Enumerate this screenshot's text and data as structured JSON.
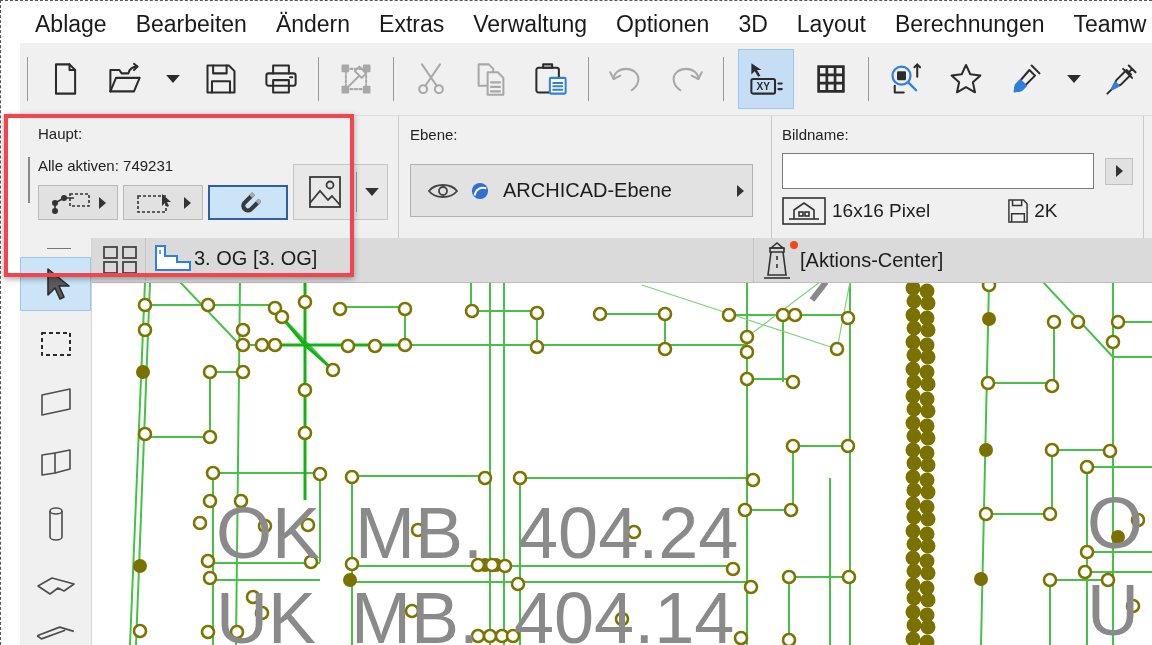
{
  "menu_bar": [
    "Ablage",
    "Bearbeiten",
    "Ändern",
    "Extras",
    "Verwaltung",
    "Optionen",
    "3D",
    "Layout",
    "Berechnungen",
    "Teamw"
  ],
  "toolbar": {
    "groups": [
      [
        {
          "kind": "button",
          "disabled": false,
          "selected": false
        },
        {
          "kind": "button",
          "disabled": false,
          "selected": false
        },
        {
          "kind": "dropdown",
          "disabled": false,
          "selected": false
        },
        {
          "kind": "button",
          "disabled": false,
          "selected": false
        },
        {
          "kind": "button",
          "disabled": false,
          "selected": false
        }
      ],
      [
        {
          "kind": "button",
          "disabled": true,
          "selected": false
        }
      ],
      [
        {
          "kind": "button",
          "disabled": true,
          "selected": false
        },
        {
          "kind": "button",
          "disabled": true,
          "selected": false
        },
        {
          "kind": "button",
          "disabled": false,
          "selected": false
        }
      ],
      [
        {
          "kind": "button",
          "disabled": true,
          "selected": false
        },
        {
          "kind": "button",
          "disabled": true,
          "selected": false
        }
      ],
      [
        {
          "kind": "button",
          "disabled": false,
          "selected": true,
          "icon_text": "XY"
        },
        {
          "kind": "button",
          "disabled": false,
          "selected": false
        }
      ],
      [
        {
          "kind": "button",
          "disabled": false,
          "selected": false
        },
        {
          "kind": "button",
          "disabled": false,
          "selected": false
        },
        {
          "kind": "button",
          "disabled": false,
          "selected": false
        },
        {
          "kind": "dropdown",
          "disabled": false,
          "selected": false
        },
        {
          "kind": "button",
          "disabled": false,
          "selected": false
        }
      ]
    ]
  },
  "info_box": {
    "main": {
      "label": "Haupt:",
      "count": "Alle aktiven: 749231",
      "buttons": [
        {
          "kind": "popup",
          "selected": false
        },
        {
          "kind": "popup",
          "selected": false
        },
        {
          "kind": "toggle",
          "selected": true
        }
      ]
    },
    "layer": {
      "label": "Ebene:",
      "value": "ARCHICAD-Ebene"
    },
    "image": {
      "label": "Bildname:",
      "size": "16x16 Pixel",
      "file_size": "2K"
    }
  },
  "tab_bar": {
    "tab": {
      "label": "3. OG [3. OG]"
    },
    "action_center": {
      "label": "[Aktions-Center]",
      "notification": true
    }
  },
  "toolbox": {
    "tools": [
      {
        "selected": true
      },
      {
        "selected": false
      },
      {
        "selected": false
      },
      {
        "selected": false
      },
      {
        "selected": false
      },
      {
        "selected": false
      },
      {
        "selected": false
      }
    ]
  },
  "canvas": {
    "labels": [
      "OK MB. 404.24",
      "UK MB. 404.14",
      "O",
      "U"
    ]
  },
  "annotations": [
    {
      "kind": "rectangle"
    }
  ]
}
